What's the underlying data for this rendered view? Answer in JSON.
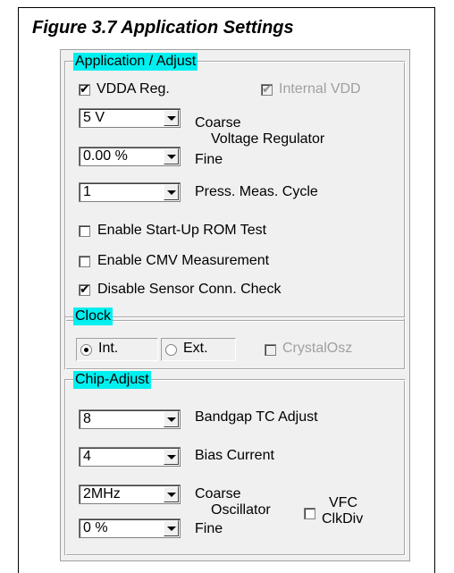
{
  "figure_title": "Figure 3.7  Application Settings",
  "app_adjust": {
    "legend": "Application / Adjust",
    "vdda_reg": {
      "label": "VDDA Reg.",
      "checked": true
    },
    "internal_vdd": {
      "label": "Internal VDD",
      "checked": true,
      "disabled": true
    },
    "coarse_value": "5 V",
    "coarse_label": "Coarse",
    "voltage_regulator_label": "Voltage Regulator",
    "fine_value": "0.00 %",
    "fine_label": "Fine",
    "press_cycle_value": "1",
    "press_cycle_label": "Press. Meas. Cycle",
    "rom_test": {
      "label": "Enable Start-Up ROM Test",
      "checked": false
    },
    "cmv_meas": {
      "label": "Enable CMV Measurement",
      "checked": false
    },
    "sensor_check": {
      "label": "Disable Sensor Conn. Check",
      "checked": true
    }
  },
  "clock": {
    "legend": "Clock",
    "int_label": "Int.",
    "ext_label": "Ext.",
    "selected": "Int.",
    "crystal": {
      "label": "CrystalOsz",
      "checked": false,
      "disabled": true
    }
  },
  "chip_adjust": {
    "legend": "Chip-Adjust",
    "bandgap_value": "8",
    "bandgap_label": "Bandgap TC Adjust",
    "bias_value": "4",
    "bias_label": "Bias Current",
    "osc_coarse_value": "2MHz",
    "osc_coarse_label": "Coarse",
    "oscillator_label": "Oscillator",
    "osc_fine_value": "0 %",
    "osc_fine_label": "Fine",
    "vfc_line1": "VFC",
    "vfc_line2": "ClkDiv",
    "vfc_checked": false
  }
}
